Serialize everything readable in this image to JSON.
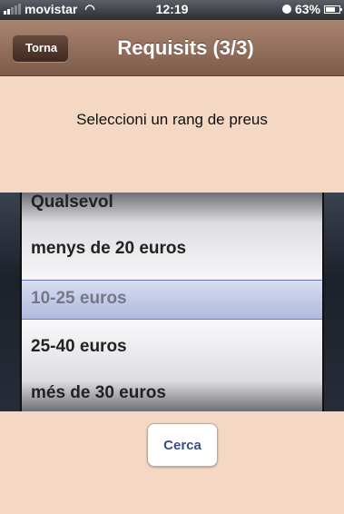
{
  "status_bar": {
    "carrier": "movistar",
    "time": "12:19",
    "battery": "63%"
  },
  "nav": {
    "back_label": "Torna",
    "title": "Requisits (3/3)"
  },
  "main": {
    "prompt": "Seleccioni un rang de preus"
  },
  "picker": {
    "options": [
      "Qualsevol",
      "menys de 20 euros",
      "10-25 euros",
      "25-40 euros",
      "més de 30 euros"
    ],
    "selected": "10-25 euros"
  },
  "actions": {
    "search_label": "Cerca"
  }
}
